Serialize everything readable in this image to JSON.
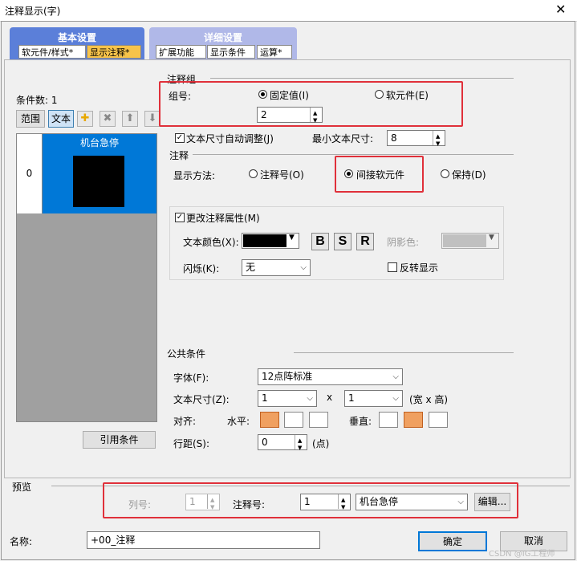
{
  "window": {
    "title": "注释显示(字)",
    "close_glyph": "✕"
  },
  "tabs": {
    "group_basic": "基本设置",
    "group_detail": "详细设置",
    "basic_items": [
      "软元件/样式*",
      "显示注释*"
    ],
    "detail_items": [
      "扩展功能",
      "显示条件",
      "运算*"
    ]
  },
  "left": {
    "condition_count_label": "条件数: 1",
    "range_button": "范围",
    "text_button": "文本",
    "list_row_index": "0",
    "list_item_label": "机台急停",
    "cite_condition_button": "引用条件"
  },
  "comment_group": {
    "section_label": "注释组",
    "group_no_label": "组号:",
    "fixed_value_label": "固定值(I)",
    "device_label": "软元件(E)",
    "group_value": "2"
  },
  "text_auto": {
    "auto_adjust_label": "文本尺寸自动调整(J)",
    "min_size_label": "最小文本尺寸:",
    "min_size_value": "8"
  },
  "comment": {
    "section_label": "注释",
    "display_method_label": "显示方法:",
    "opt_comment_no": "注释号(O)",
    "opt_indirect": "间接软元件",
    "opt_hold": "保持(D)"
  },
  "attributes": {
    "change_attr_label": "更改注释属性(M)",
    "text_color_label": "文本颜色(X):",
    "text_color": "#000000",
    "bold_label": "B",
    "shadow_label": "S",
    "raised_label": "R",
    "shadow_color_label": "阴影色:",
    "blink_label": "闪烁(K):",
    "blink_value": "无",
    "reverse_label": "反转显示"
  },
  "common": {
    "section_label": "公共条件",
    "font_label": "字体(F):",
    "font_value": "12点阵标准",
    "text_size_label": "文本尺寸(Z):",
    "width_value": "1",
    "times": "x",
    "height_value": "1",
    "size_unit": "(宽 x 高)",
    "align_label": "对齐:",
    "horizontal_label": "水平:",
    "vertical_label": "垂直:",
    "line_spacing_label": "行距(S):",
    "line_spacing_value": "0",
    "line_spacing_unit": "(点)"
  },
  "preview": {
    "section_label": "预览",
    "column_label": "列号:",
    "column_value": "1",
    "comment_no_label": "注释号:",
    "comment_no_value": "1",
    "comment_text": "机台急停",
    "edit_button": "编辑..."
  },
  "footer": {
    "name_label": "名称:",
    "name_value": "+00_注释",
    "ok_button": "确定",
    "cancel_button": "取消",
    "watermark": "CSDN @IG工程师"
  }
}
